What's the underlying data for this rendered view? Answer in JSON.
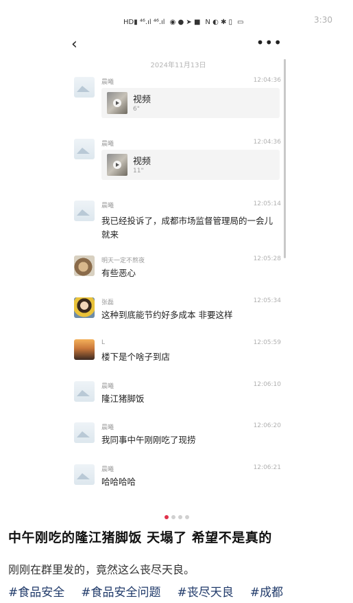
{
  "status": {
    "time": "3:30"
  },
  "chat": {
    "date": "2024年11月13日",
    "messages": [
      {
        "sender": "晨曦",
        "time": "12:04:36",
        "type": "video",
        "title": "视频",
        "duration": "6\""
      },
      {
        "sender": "晨曦",
        "time": "12:04:36",
        "type": "video",
        "title": "视频",
        "duration": "11\""
      },
      {
        "sender": "晨曦",
        "time": "12:05:14",
        "type": "text",
        "text": "我已经投诉了，成都市场监督管理局的一会儿就来"
      },
      {
        "sender": "明天一定不熬夜",
        "time": "12:05:28",
        "type": "text",
        "text": "有些恶心"
      },
      {
        "sender": "张磊",
        "time": "12:05:34",
        "type": "text",
        "text": "这种到底能节约好多成本 非要这样"
      },
      {
        "sender": "L",
        "time": "12:05:59",
        "type": "text",
        "text": "楼下是个啥子到店"
      },
      {
        "sender": "晨曦",
        "time": "12:06:10",
        "type": "text",
        "text": "隆江猪脚饭"
      },
      {
        "sender": "晨曦",
        "time": "12:06:20",
        "type": "text",
        "text": "我同事中午刚刚吃了现捞"
      },
      {
        "sender": "晨曦",
        "time": "12:06:21",
        "type": "text",
        "text": "哈哈哈哈"
      }
    ]
  },
  "post": {
    "title": "中午刚吃的隆江猪脚饭 天塌了 希望不是真的",
    "body": "刚刚在群里发的，竟然这么丧尽天良。",
    "tags": [
      "#食品安全",
      "#食品安全问题",
      "#丧尽天良",
      "#成都"
    ]
  },
  "carousel": {
    "count": 4,
    "active": 1
  }
}
